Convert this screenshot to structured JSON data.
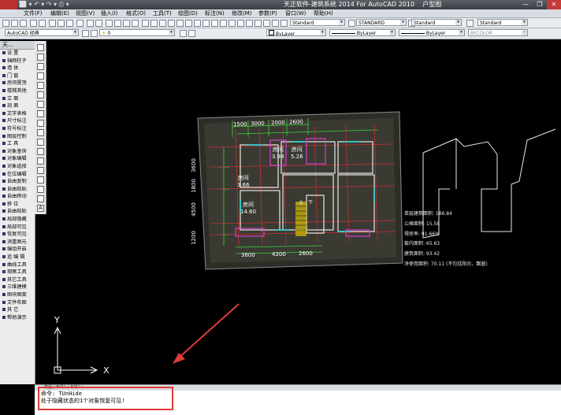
{
  "title_bar": {
    "title": "天正软件-建筑系统 2014  For AutoCAD 2010",
    "extra": "户型图",
    "quick_access": "⬜ ▾ ↶ ▾ ↷ ▾ ⎙ ▾",
    "win_controls": [
      "—",
      "❐",
      "✕"
    ]
  },
  "menubar": [
    "文件(F)",
    "编辑(E)",
    "视图(V)",
    "插入(I)",
    "格式(O)",
    "工具(T)",
    "绘图(D)",
    "标注(N)",
    "修改(M)",
    "参数(P)",
    "窗口(W)",
    "帮助(H)"
  ],
  "toolbar_combos": {
    "style_text": "Standard",
    "dim_style": "STANDARD",
    "table_style": "Standard",
    "ml_style": "Standard",
    "workspace": "AutoCAD 经典",
    "layer": "0",
    "color": "ByLayer",
    "linetype": "ByLayer",
    "lineweight": "ByLayer",
    "plot": "BYCOLOR"
  },
  "sidebar": {
    "header": "天...",
    "items": [
      "设  置",
      "轴网柱子",
      "墙  体",
      "门  窗",
      "房间屋顶",
      "楼梯其他",
      "立  面",
      "剖  面",
      "文字表格",
      "尺寸标注",
      "符号标注",
      "图层控制",
      "工  具",
      "对象查询",
      "对象编辑",
      "对象选择",
      "在位编辑",
      "自由复制",
      "自由粘贴",
      "自由移动",
      "移  位",
      "自由粘贴",
      "局部隐藏",
      "局部可见",
      "恢复可见",
      "消重图元",
      "编组开启",
      "追 编 辑",
      "曲线工具",
      "观察工具",
      "其它工具",
      "三维建模",
      "图块图案",
      "文件布图",
      "其  它",
      "帮助演示"
    ]
  },
  "canvas": {
    "dims_top": [
      "1500",
      "3000",
      "2000",
      "2600"
    ],
    "dims_bottom": [
      "3600",
      "4200",
      "2600"
    ],
    "dims_left": [
      "3600",
      "1800",
      "4500",
      "1200"
    ],
    "rooms": [
      {
        "name": "房间",
        "area": "3.94"
      },
      {
        "name": "房间",
        "area": "5.26"
      },
      {
        "name": "房间",
        "area": "3.66"
      },
      {
        "name": "房间",
        "area": "14.60"
      }
    ],
    "stair_labels": [
      "上",
      "下"
    ],
    "axis_y": "Y",
    "axis_x": "X"
  },
  "stats": [
    "单层建筑面积: 186.84",
    "公摊面积: 15.58",
    "得房率: 91.66%",
    "套内面积: 65.63",
    "建筑面积: 93.42",
    "净使用面积: 70.11 (不包括阳台、飘窗)"
  ],
  "command": {
    "tabs": "模型 / 布局1 / 布局2 /",
    "line1": "命令: TUnHide",
    "line2": "处于隐藏状态的1个对象恢复可见!"
  },
  "colors": {
    "annotation_red": "#e23b3b",
    "dim_green": "#3cd63c",
    "wall_cyan": "#2ee0e0",
    "magenta": "#d040d0"
  }
}
